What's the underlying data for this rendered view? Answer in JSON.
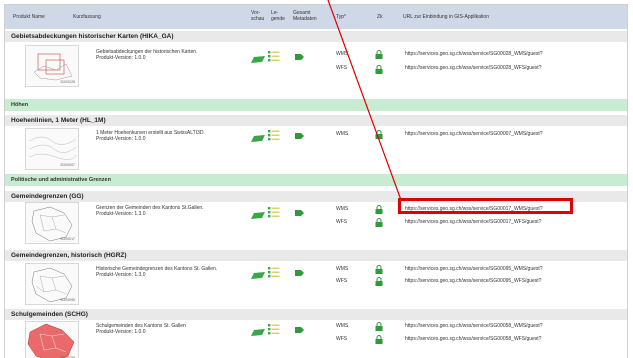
{
  "header": {
    "produkt_name": "Produkt Name",
    "kurzfassung": "Kurzfassung",
    "vorschau": "Vor-\nschau",
    "legende": "Le-\ngende",
    "gesamt_metadaten": "Gesamt\nMetadaten",
    "typ": "Typ*",
    "zugriff": "Zk",
    "url": "URL zur Einbindung in GIS-Applikation"
  },
  "groups": {
    "hoehen": "Höhen",
    "politische": "Politische und administrative Grenzen"
  },
  "products": {
    "hika": {
      "title": "Gebietsabdeckungen historischer Karten (HIKA_GA)",
      "desc": "Gebietsabdeckungen der historischen Karten.\nProdukt-Version: 1.0.0",
      "thumb_id": "SG00028",
      "services": [
        {
          "type": "WMS",
          "url": "https://services.geo.sg.ch/wss/service/SG00028_WMS/guest?"
        },
        {
          "type": "WFS",
          "url": "https://services.geo.sg.ch/wss/service/SG00028_WFS/guest?"
        }
      ]
    },
    "hl": {
      "title": "Hoehenlinien, 1 Meter (HL_1M)",
      "desc": "1 Meter Hoehenkurven erstellt aus SwissALTI3D.\nProdukt-Version: 1.0.0",
      "thumb_id": "SG00007",
      "services": [
        {
          "type": "WMS",
          "url": "https://services.geo.sg.ch/wss/service/SG00007_WMS/guest?"
        }
      ]
    },
    "gg": {
      "title": "Gemeindegrenzen (GG)",
      "desc": "Grenzen der Gemeinden des Kantons St.Gallen.\nProdukt-Version: 1.3.0",
      "thumb_id": "SG00017",
      "services": [
        {
          "type": "WMS",
          "url": "https://services.geo.sg.ch/wss/service/SG00017_WMS/guest?"
        },
        {
          "type": "WFS",
          "url": "https://services.geo.sg.ch/wss/service/SG00017_WFS/guest?"
        }
      ]
    },
    "hgrz": {
      "title": "Gemeindegrenzen, historisch (HGRZ)",
      "desc": "Historische Gemeindegrenzen des Kantons St. Gallen.\nProdukt-Version: 1.3.0",
      "thumb_id": "SG00095",
      "services": [
        {
          "type": "WMS",
          "url": "https://services.geo.sg.ch/wss/service/SG00095_WMS/guest?"
        },
        {
          "type": "WFS",
          "url": "https://services.geo.sg.ch/wss/service/SG00095_WFS/guest?"
        }
      ]
    },
    "schg": {
      "title": "Schulgemeinden (SCHG)",
      "desc": "Schulgemeinden des Kantons St. Gallen\nProdukt-Version: 1.0.0",
      "thumb_id": "SG00058",
      "services": [
        {
          "type": "WMS",
          "url": "https://services.geo.sg.ch/wss/service/SG00058_WMS/guest?"
        },
        {
          "type": "WFS",
          "url": "https://services.geo.sg.ch/wss/service/SG00058_WFS/guest?"
        }
      ]
    }
  },
  "colors": {
    "header_bg": "#cfd8e6",
    "group_bg": "#c8ecd2",
    "title_bg": "#e9e9e9",
    "accent_green": "#2e9a3a",
    "highlight_red": "#e00000"
  },
  "icons": [
    "preview-icon",
    "legend-list-icon",
    "metadata-tag-icon",
    "lock-icon"
  ]
}
